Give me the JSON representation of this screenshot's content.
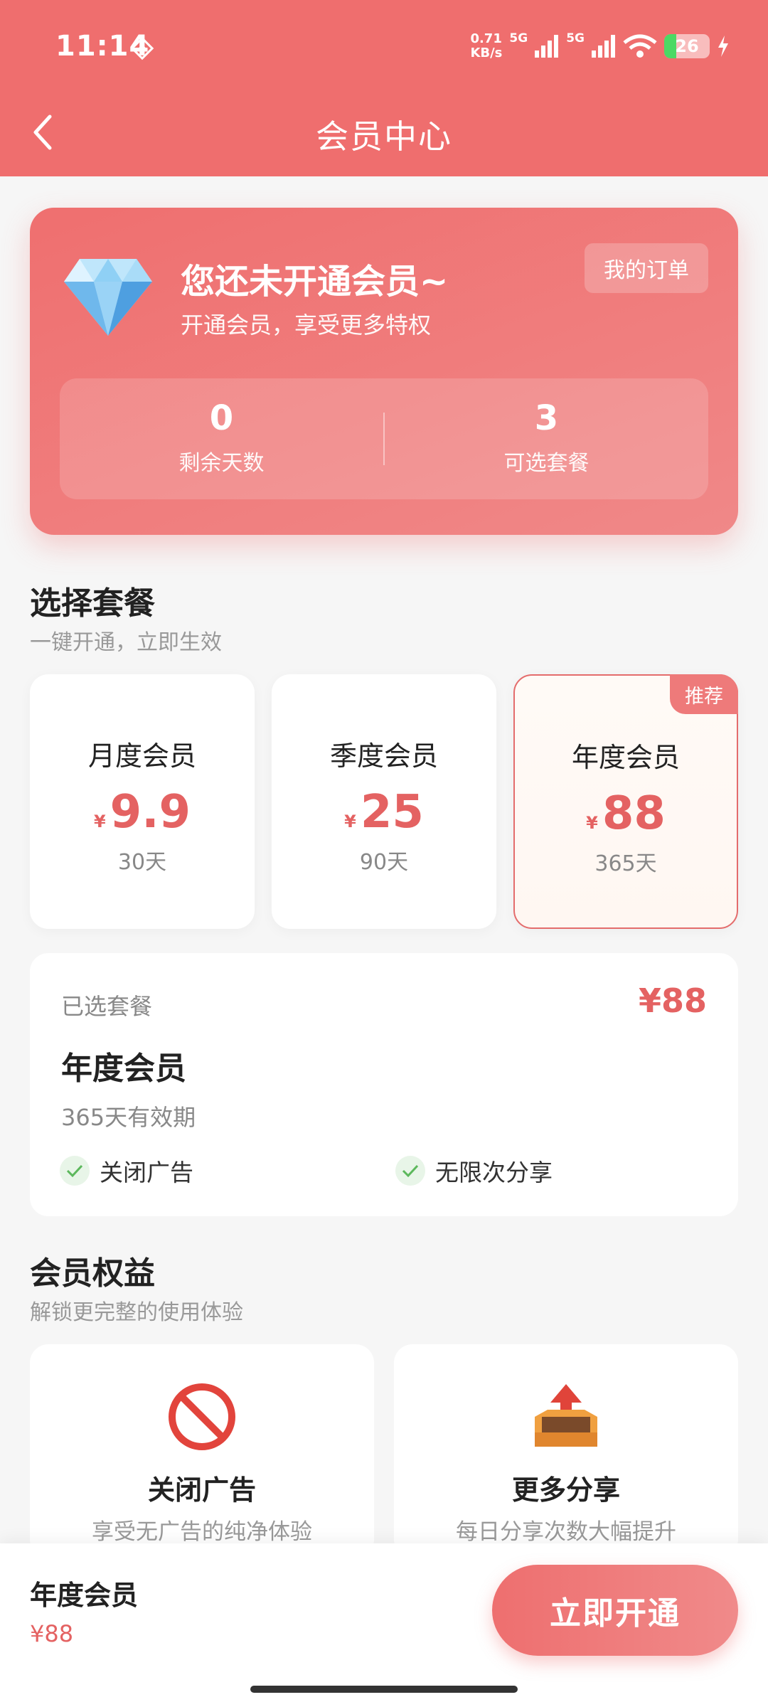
{
  "status_bar": {
    "time": "11:14",
    "net_speed_value": "0.71",
    "net_speed_unit": "KB/s",
    "sim1": "5G",
    "sim2": "5G",
    "battery": "26",
    "battery_level": 0.26
  },
  "nav": {
    "title": "会员中心"
  },
  "hero": {
    "title": "您还未开通会员~",
    "subtitle": "开通会员，享受更多特权",
    "orders_button": "我的订单",
    "stats": [
      {
        "value": "0",
        "label": "剩余天数"
      },
      {
        "value": "3",
        "label": "可选套餐"
      }
    ]
  },
  "plans_section": {
    "title": "选择套餐",
    "subtitle": "一键开通，立即生效"
  },
  "plans": [
    {
      "name": "月度会员",
      "currency": "¥",
      "price": "9.9",
      "days": "30天"
    },
    {
      "name": "季度会员",
      "currency": "¥",
      "price": "25",
      "days": "90天"
    },
    {
      "name": "年度会员",
      "currency": "¥",
      "price": "88",
      "days": "365天",
      "badge": "推荐",
      "selected": true
    }
  ],
  "summary": {
    "label": "已选套餐",
    "price": "¥88",
    "name": "年度会员",
    "validity": "365天有效期",
    "features": [
      "关闭广告",
      "无限次分享"
    ]
  },
  "benefits_section": {
    "title": "会员权益",
    "subtitle": "解锁更完整的使用体验"
  },
  "benefits": [
    {
      "title": "关闭广告",
      "desc": "享受无广告的纯净体验",
      "icon": "no-ads-icon"
    },
    {
      "title": "更多分享",
      "desc": "每日分享次数大幅提升",
      "icon": "share-tray-icon"
    }
  ],
  "bottom_bar": {
    "name": "年度会员",
    "price": "¥88",
    "button": "立即开通"
  },
  "colors": {
    "primary": "#ef6e6e",
    "price": "#e46262",
    "check": "#5cb85c"
  }
}
